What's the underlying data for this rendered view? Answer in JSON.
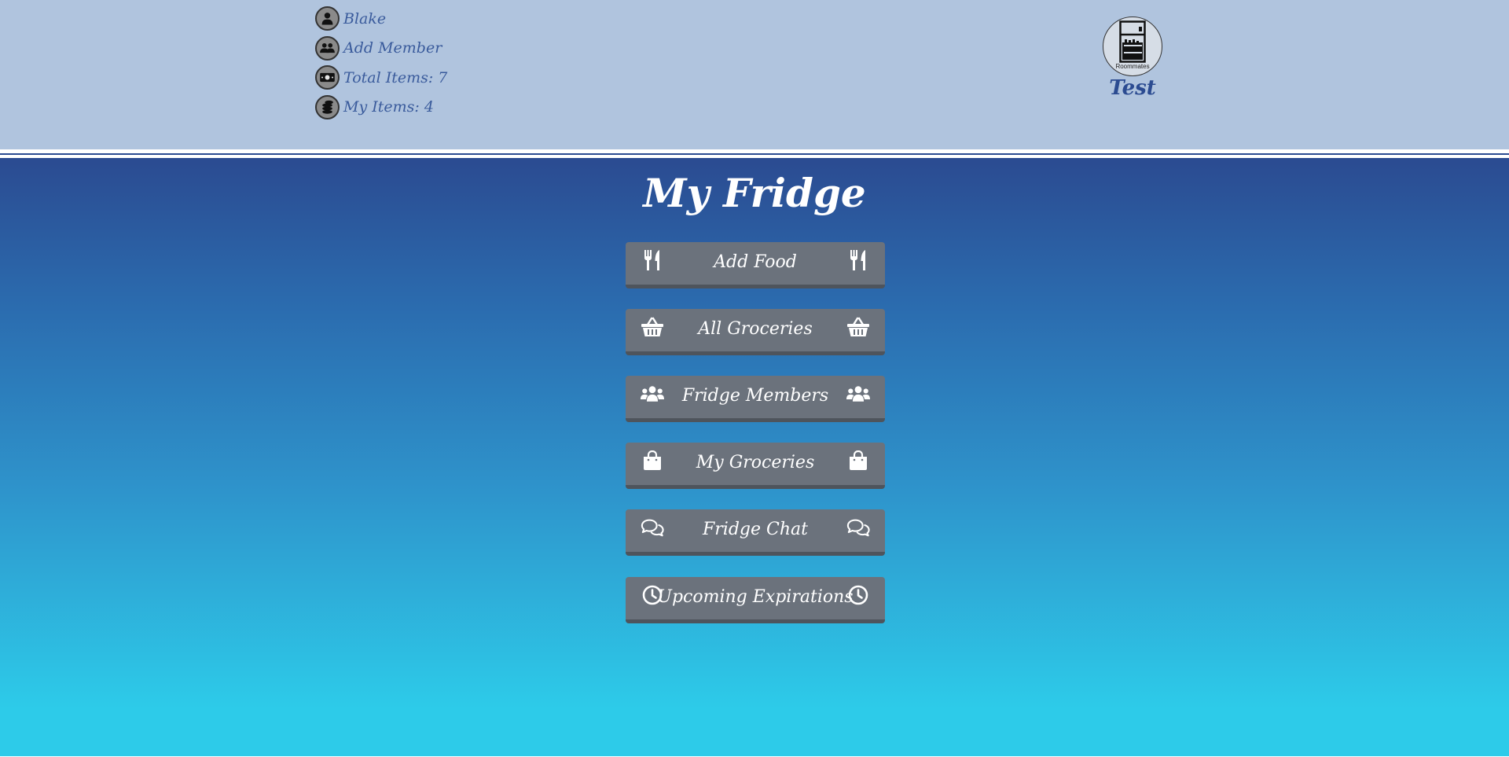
{
  "header": {
    "user_menu": [
      {
        "label": "Blake",
        "icon": "user-icon"
      },
      {
        "label": "Add Member",
        "icon": "users-icon"
      },
      {
        "label": "Total Items: 7",
        "icon": "money-bill-icon"
      },
      {
        "label": "My Items: 4",
        "icon": "coins-icon"
      }
    ],
    "fridge_badge": {
      "label": "Roommates",
      "icon": "fridge-icon"
    },
    "fridge_name": "Test"
  },
  "main": {
    "title": "My Fridge",
    "buttons": [
      {
        "label": "Add Food",
        "icon": "utensils-icon"
      },
      {
        "label": "All Groceries",
        "icon": "basket-icon"
      },
      {
        "label": "Fridge Members",
        "icon": "users-icon"
      },
      {
        "label": "My Groceries",
        "icon": "shopping-bag-icon"
      },
      {
        "label": "Fridge Chat",
        "icon": "comments-icon"
      },
      {
        "label": "Upcoming Expirations",
        "icon": "clock-icon"
      }
    ]
  },
  "colors": {
    "header_bg": "#b0c4de",
    "header_text": "#3a5b9c",
    "fridge_name": "#2b4b91",
    "gradient_top": "#2b4b91",
    "gradient_bottom": "#2dcbe9",
    "button_bg": "#6b727c",
    "button_text": "#ffffff"
  }
}
